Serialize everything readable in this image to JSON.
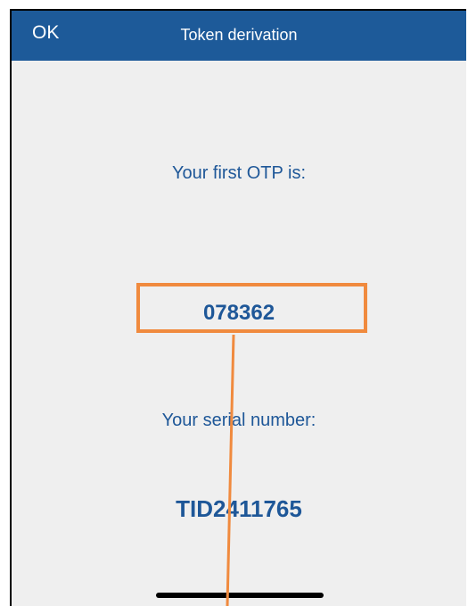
{
  "navbar": {
    "ok_label": "OK",
    "title": "Token derivation",
    "background": "#1d5a99"
  },
  "otp": {
    "label": "Your first OTP is:",
    "value": "078362"
  },
  "serial": {
    "label": "Your serial number:",
    "value": "TID2411765"
  },
  "annotation": {
    "color": "#f08a3e"
  },
  "colors": {
    "text_accent": "#1e5798",
    "screen_background": "#efefef"
  }
}
